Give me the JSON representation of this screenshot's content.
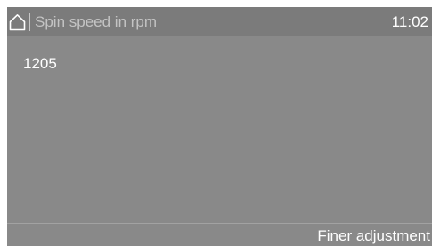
{
  "header": {
    "title": "Spin speed in rpm",
    "time": "11:02",
    "home_icon": "home-icon"
  },
  "list": {
    "items": [
      {
        "value": "1205"
      },
      {
        "value": ""
      },
      {
        "value": ""
      }
    ]
  },
  "footer": {
    "action_label": "Finer adjustment"
  },
  "colors": {
    "screen_background": "#898989",
    "header_background": "#7b7b7b",
    "text_primary": "#ffffff",
    "text_dimmed": "#c4c4c4",
    "divider": "#d6d6d6"
  }
}
